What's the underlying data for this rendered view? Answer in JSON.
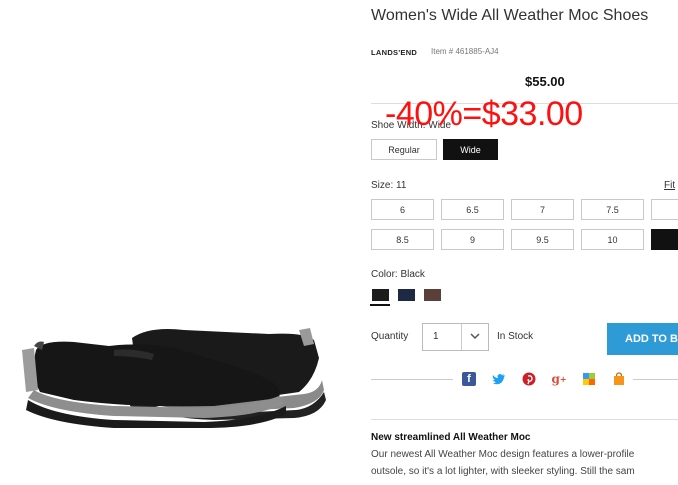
{
  "product": {
    "title": "Women's Wide All Weather Moc Shoes",
    "brand": "LANDS'END",
    "item_number": "Item # 461885-AJ4",
    "price": "$55.00",
    "discount_overlay": "-40%=$33.00"
  },
  "shoe_width": {
    "label": "Shoe Width: Wide",
    "options": [
      "Regular",
      "Wide"
    ],
    "selected": "Wide"
  },
  "size": {
    "label": "Size:  11",
    "fit_link": "Fit",
    "row1": [
      "6",
      "6.5",
      "7",
      "7.5"
    ],
    "row2": [
      "8.5",
      "9",
      "9.5",
      "10"
    ],
    "selected": "11"
  },
  "color": {
    "label": "Color: Black",
    "swatches": [
      {
        "name": "Black",
        "hex": "#1c1c1c"
      },
      {
        "name": "Navy",
        "hex": "#1e2a44"
      },
      {
        "name": "Brown",
        "hex": "#5a4038"
      }
    ],
    "selected": "Black"
  },
  "purchase": {
    "quantity_label": "Quantity",
    "quantity_value": "1",
    "stock_status": "In Stock",
    "add_button": "ADD TO B"
  },
  "share_icons": [
    "facebook-icon",
    "twitter-icon",
    "pinterest-icon",
    "google-plus-icon",
    "delicious-icon",
    "shopping-bag-icon"
  ],
  "colors": {
    "accent": "#2e9bd6",
    "discount": "#ff1010",
    "facebook": "#3b5998",
    "twitter": "#1da1f2",
    "pinterest": "#cb2027",
    "google_plus": "#dd4b39",
    "bag": "#f7941d"
  },
  "description": {
    "heading": "New streamlined All Weather Moc",
    "line1": "Our newest All Weather Moc design features a lower-profile",
    "line2": "outsole, so it's a lot lighter, with sleeker styling. Still the sam"
  }
}
